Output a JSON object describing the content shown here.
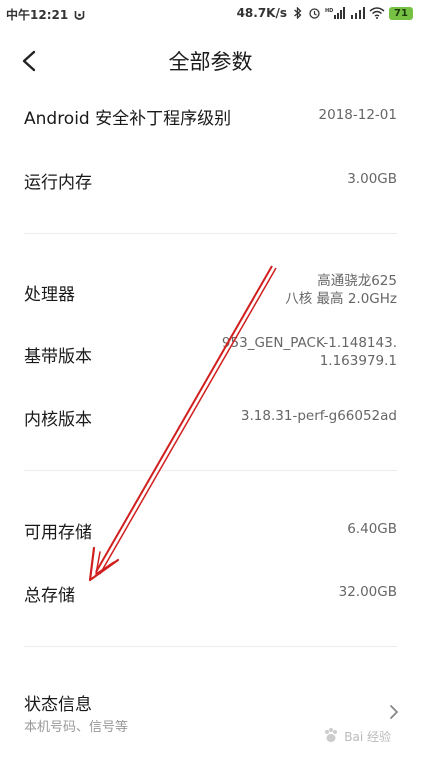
{
  "status_bar": {
    "time": "中午12:21",
    "speed": "48.7K/s",
    "battery": "71"
  },
  "header": {
    "title": "全部参数"
  },
  "params": [
    {
      "label": "Android 安全补丁程序级别",
      "value": "2018-12-01"
    },
    {
      "label": "运行内存",
      "value": "3.00GB"
    },
    {
      "label": "处理器",
      "value_line1": "高通骁龙625",
      "value_line2": "八核 最高 2.0GHz"
    },
    {
      "label": "基带版本",
      "value_line1": "953_GEN_PACK-1.148143.",
      "value_line2": "1.163979.1"
    },
    {
      "label": "内核版本",
      "value": "3.18.31-perf-g66052ad"
    },
    {
      "label": "可用存储",
      "value": "6.40GB"
    },
    {
      "label": "总存储",
      "value": "32.00GB"
    }
  ],
  "status_info": {
    "label": "状态信息",
    "subtitle": "本机号码、信号等"
  },
  "watermark": {
    "text": "Bai 经验"
  },
  "colors": {
    "annotation_arrow": "#d11f1f",
    "battery": "#76c043"
  },
  "icons": [
    "back-arrow-icon",
    "chevron-right-icon",
    "bluetooth-icon",
    "alarm-icon",
    "signal-icon",
    "wifi-icon",
    "battery-icon"
  ]
}
